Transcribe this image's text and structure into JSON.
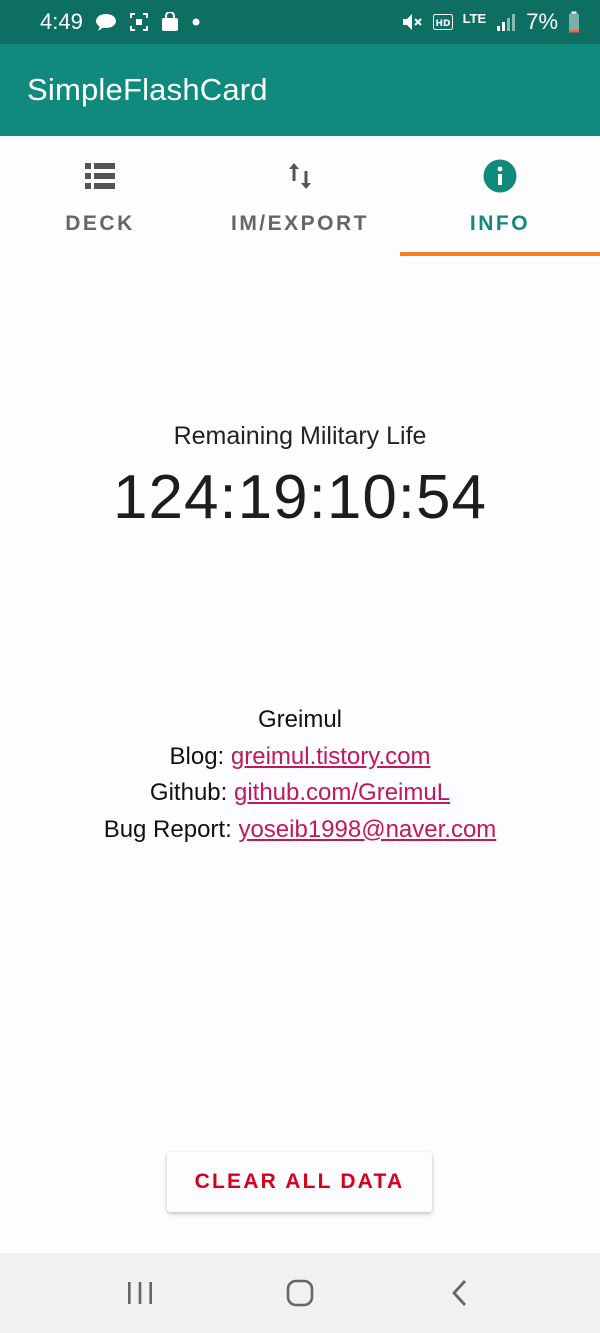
{
  "status_bar": {
    "time": "4:49",
    "network": "LTE",
    "battery": "7%",
    "icons": [
      "speech-bubble-icon",
      "screenshot-icon",
      "shopping-bag-icon",
      "dot-icon",
      "mute-icon",
      "hd-icon",
      "signal-icon",
      "battery-icon"
    ]
  },
  "app_bar": {
    "title": "SimpleFlashCard"
  },
  "tabs": [
    {
      "label": "DECK",
      "icon": "list-icon",
      "active": false
    },
    {
      "label": "IM/EXPORT",
      "icon": "swap-vertical-icon",
      "active": false
    },
    {
      "label": "INFO",
      "icon": "info-icon",
      "active": true
    }
  ],
  "main": {
    "military_label": "Remaining Military Life",
    "countdown": "124:19:10:54",
    "author": "Greimul",
    "blog_label": "Blog:",
    "blog_link": "greimul.tistory.com",
    "github_label": "Github:",
    "github_link": "github.com/GreimuL",
    "bug_label": "Bug Report:",
    "bug_link": "yoseib1998@naver.com",
    "clear_button": "CLEAR ALL DATA"
  },
  "colors": {
    "status_bar": "#0c6f62",
    "app_bar": "#0f8a7d",
    "accent": "#0f8a7d",
    "indicator": "#f58220",
    "link": "#c2185b",
    "danger": "#d6001c"
  },
  "nav_bar": {
    "buttons": [
      "recent-apps-icon",
      "home-icon",
      "back-icon"
    ]
  }
}
